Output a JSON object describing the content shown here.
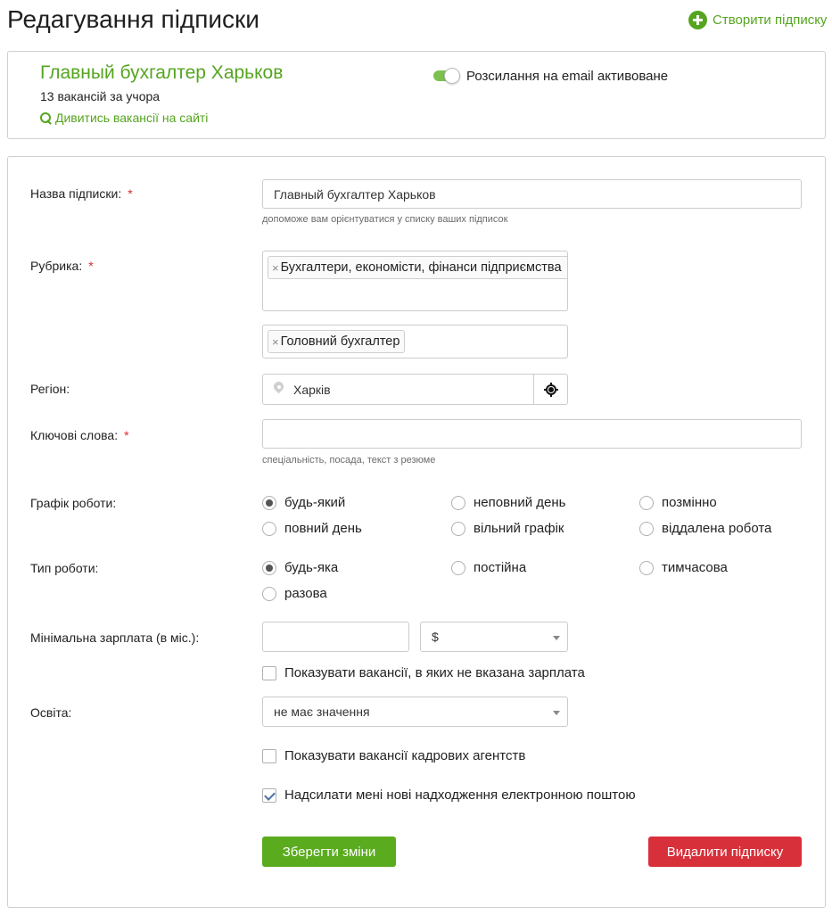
{
  "header": {
    "title": "Редагування підписки",
    "create_label": "Створити підписку"
  },
  "summary": {
    "name": "Главный бухгалтер Харьков",
    "vacancies": "13 вакансій за учора",
    "view_link": "Дивитись вакансії на сайті",
    "email_toggle_label": "Розсилання на email активоване",
    "email_toggle_on": true
  },
  "form": {
    "name": {
      "label": "Назва підписки:",
      "required": "*",
      "value": "Главный бухгалтер Харьков",
      "hint": "допоможе вам орієнтуватися у списку ваших підписок"
    },
    "rubric": {
      "label": "Рубрика:",
      "required": "*",
      "tag1": "Бухгалтери, економісти, фінанси підприємства",
      "tag2": "Головний бухгалтер",
      "remove": "×"
    },
    "region": {
      "label": "Регіон:",
      "value": "Харків"
    },
    "keywords": {
      "label": "Ключові слова:",
      "required": "*",
      "value": "",
      "hint": "спеціальність, посада, текст з резюме"
    },
    "schedule": {
      "label": "Графік роботи:",
      "options": [
        "будь-який",
        "неповний день",
        "позмінно",
        "повний день",
        "вільний графік",
        "віддалена робота"
      ],
      "selected": "будь-який"
    },
    "work_type": {
      "label": "Тип роботи:",
      "options": [
        "будь-яка",
        "постійна",
        "тимчасова",
        "разова"
      ],
      "selected": "будь-яка"
    },
    "salary": {
      "label": "Мінімальна зарплата (в міс.):",
      "value": "",
      "currency": "$",
      "show_unspecified_label": "Показувати вакансії, в яких не вказана зарплата",
      "show_unspecified": false
    },
    "education": {
      "label": "Освіта:",
      "value": "не має значення"
    },
    "agencies_label": "Показувати вакансії кадрових агентств",
    "agencies_checked": false,
    "email_label": "Надсилати мені нові надходження електронною поштою",
    "email_checked": true
  },
  "actions": {
    "save": "Зберегти зміни",
    "delete": "Видалити підписку"
  },
  "colors": {
    "accent": "#55a520",
    "save": "#5aab1e",
    "delete": "#d8303a",
    "required": "#d62b2b"
  }
}
